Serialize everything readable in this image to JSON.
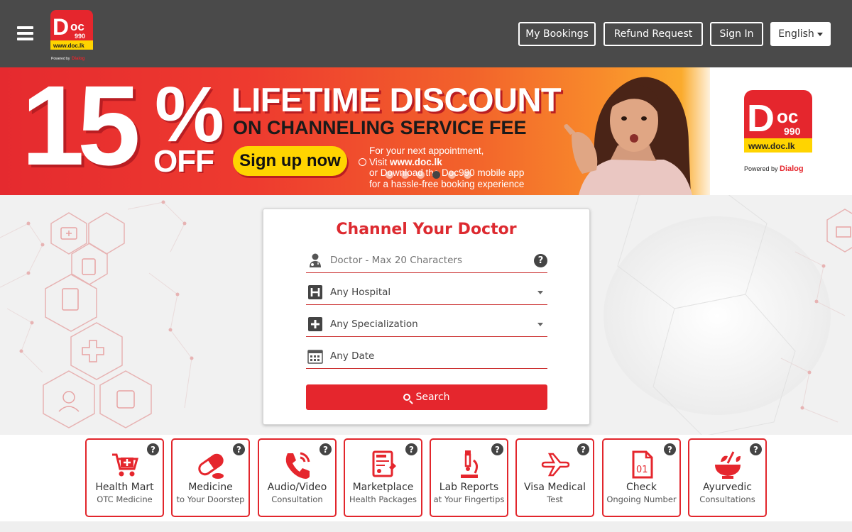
{
  "header": {
    "logo_text": "Doc 990",
    "logo_url": "www.doc.lk",
    "logo_powered": "Powered by Dialog",
    "buttons": {
      "my_bookings": "My Bookings",
      "refund_request": "Refund Request",
      "sign_in": "Sign In",
      "language": "English"
    }
  },
  "banner": {
    "discount_number": "15",
    "discount_symbol": "%",
    "discount_off": "OFF",
    "headline": "LIFETIME DISCOUNT",
    "subheadline": "ON CHANNELING SERVICE FEE",
    "cta": "Sign up now",
    "small_line1": "For your next appointment,",
    "small_line2_prefix": "Visit ",
    "small_line2_bold": "www.doc.lk",
    "small_line3": "or Download the Doc990 mobile app",
    "small_line4": "for a hassle-free booking experience",
    "logo_url": "www.doc.lk",
    "powered_by": "Powered by",
    "powered_brand": "Dialog",
    "slide_count": 6,
    "active_slide": 3
  },
  "search_card": {
    "title": "Channel Your Doctor",
    "doctor_placeholder": "Doctor - Max 20 Characters",
    "hospital_value": "Any Hospital",
    "specialization_value": "Any Specialization",
    "date_value": "Any Date",
    "search_label": "Search"
  },
  "services": [
    {
      "title": "Health Mart",
      "subtitle": "OTC Medicine",
      "icon": "cart-icon"
    },
    {
      "title": "Medicine",
      "subtitle": "to Your Doorstep",
      "icon": "capsule-icon"
    },
    {
      "title": "Audio/Video",
      "subtitle": "Consultation",
      "icon": "phone-icon"
    },
    {
      "title": "Marketplace",
      "subtitle": "Health Packages",
      "icon": "health-package-icon"
    },
    {
      "title": "Lab Reports",
      "subtitle": "at Your Fingertips",
      "icon": "microscope-icon"
    },
    {
      "title": "Visa Medical",
      "subtitle": "Test",
      "icon": "airplane-icon"
    },
    {
      "title": "Check",
      "subtitle": "Ongoing Number",
      "icon": "document-number-icon"
    },
    {
      "title": "Ayurvedic",
      "subtitle": "Consultations",
      "icon": "mortar-icon"
    }
  ],
  "colors": {
    "header_bg": "#4a4a4a",
    "brand_red": "#e5262d",
    "banner_yellow": "#ffd400"
  }
}
